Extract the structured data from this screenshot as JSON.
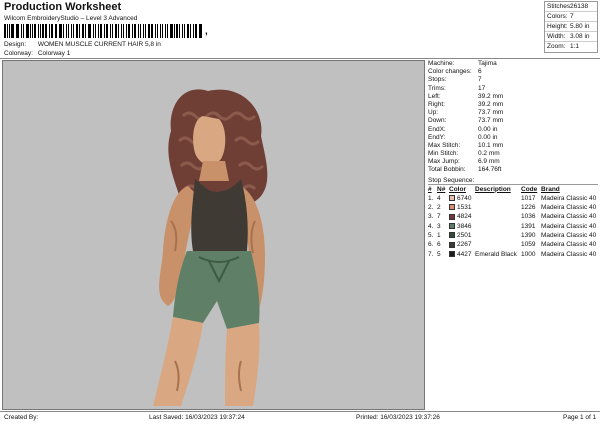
{
  "header": {
    "title": "Production Worksheet",
    "subtitle": "Wilcom EmbroideryStudio – Level 3 Advanced",
    "comma": ",",
    "design_label": "Design:",
    "design_value": "WOMEN MUSCLE CURRENT HAIR 5,8 in",
    "colorway_label": "Colorway:",
    "colorway_value": "Colorway 1"
  },
  "summary": [
    {
      "key": "Stitches:",
      "value": "26138"
    },
    {
      "key": "Colors:",
      "value": "7"
    },
    {
      "key": "Height:",
      "value": "5.80 in"
    },
    {
      "key": "Width:",
      "value": "3.08 in"
    },
    {
      "key": "Zoom:",
      "value": "1:1"
    }
  ],
  "details": [
    {
      "key": "Machine:",
      "value": "Tajima"
    },
    {
      "key": "Color changes:",
      "value": "6"
    },
    {
      "key": "Stops:",
      "value": "7"
    },
    {
      "key": "Trims:",
      "value": "17"
    },
    {
      "key": "Left:",
      "value": "39.2 mm"
    },
    {
      "key": "Right:",
      "value": "39.2 mm"
    },
    {
      "key": "Up:",
      "value": "73.7 mm"
    },
    {
      "key": "Down:",
      "value": "73.7 mm"
    },
    {
      "key": "EndX:",
      "value": "0.00 in"
    },
    {
      "key": "EndY:",
      "value": "0.00 in"
    },
    {
      "key": "Max Stitch:",
      "value": "10.1 mm"
    },
    {
      "key": "Min Stitch:",
      "value": "0.2 mm"
    },
    {
      "key": "Max Jump:",
      "value": "6.9 mm"
    },
    {
      "key": "Total Bobbin:",
      "value": "164.76ft"
    }
  ],
  "stop_sequence": {
    "title": "Stop Sequence:",
    "columns": [
      "#",
      "N#",
      "Color",
      "Description",
      "Code",
      "Brand"
    ],
    "rows": [
      {
        "n": "1.",
        "needle": "4",
        "color": "#e9bfae",
        "number": "6740",
        "description": "",
        "code": "1017",
        "brand": "Madeira Classic 40"
      },
      {
        "n": "2.",
        "needle": "2",
        "color": "#d98a70",
        "number": "1531",
        "description": "",
        "code": "1226",
        "brand": "Madeira Classic 40"
      },
      {
        "n": "3.",
        "needle": "7",
        "color": "#6e3a3a",
        "number": "4824",
        "description": "",
        "code": "1036",
        "brand": "Madeira Classic 40"
      },
      {
        "n": "4.",
        "needle": "3",
        "color": "#5d7e64",
        "number": "3846",
        "description": "",
        "code": "1391",
        "brand": "Madeira Classic 40"
      },
      {
        "n": "5.",
        "needle": "1",
        "color": "#2f4a36",
        "number": "2501",
        "description": "",
        "code": "1390",
        "brand": "Madeira Classic 40"
      },
      {
        "n": "6.",
        "needle": "6",
        "color": "#3d3a36",
        "number": "2267",
        "description": "",
        "code": "1059",
        "brand": "Madeira Classic 40"
      },
      {
        "n": "7.",
        "needle": "5",
        "color": "#1a1f1a",
        "number": "4427",
        "description": "Emerald Black",
        "code": "1000",
        "brand": "Madeira Classic 40"
      }
    ]
  },
  "footer": {
    "created_by": "Created By:",
    "last_saved": "Last Saved: 16/03/2023 19:37:24",
    "printed": "Printed: 16/03/2023 19:37:26",
    "page": "Page 1 of 1"
  }
}
